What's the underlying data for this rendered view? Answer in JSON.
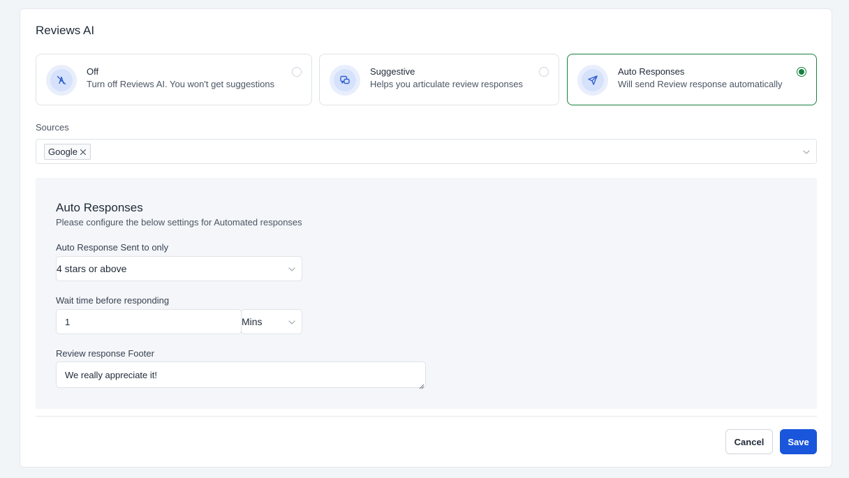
{
  "page": {
    "title": "Reviews AI"
  },
  "modes": [
    {
      "title": "Off",
      "description": "Turn off Reviews AI. You won't get suggestions",
      "icon": "ai-off-icon",
      "selected": false
    },
    {
      "title": "Suggestive",
      "description": "Helps you articulate review responses",
      "icon": "chat-bubbles-icon",
      "selected": false
    },
    {
      "title": "Auto Responses",
      "description": "Will send Review response automatically",
      "icon": "send-icon",
      "selected": true
    }
  ],
  "sources": {
    "label": "Sources",
    "tags": [
      "Google"
    ]
  },
  "auto_responses": {
    "title": "Auto Responses",
    "subtitle": "Please configure the below settings for Automated responses",
    "sent_to": {
      "label": "Auto Response Sent to only",
      "value": "4 stars or above"
    },
    "wait_time": {
      "label": "Wait time before responding",
      "value": "1",
      "unit": "Mins"
    },
    "footer": {
      "label": "Review response Footer",
      "value": "We really appreciate it!"
    }
  },
  "actions": {
    "cancel_label": "Cancel",
    "save_label": "Save"
  },
  "colors": {
    "accent": "#1a56db",
    "selected_border": "#15803d",
    "icon_bg": "#e8eefc",
    "panel_bg": "#f4f6f9"
  }
}
